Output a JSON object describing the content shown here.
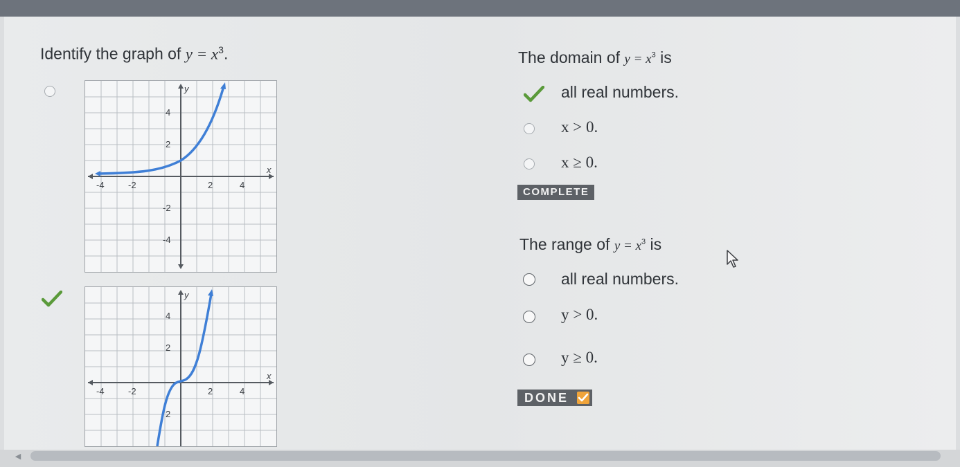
{
  "left_question": {
    "prompt_text": "Identify the graph of ",
    "equation": "y = x",
    "exponent": "3",
    "trailing": "."
  },
  "graph_options": [
    {
      "state": "unselected",
      "y_label": "y",
      "x_label": "x",
      "x_ticks": [
        "-4",
        "-2",
        "2",
        "4"
      ],
      "y_ticks": [
        "4",
        "2",
        "-2",
        "-4"
      ]
    },
    {
      "state": "correct",
      "y_label": "y",
      "x_label": "x",
      "x_ticks": [
        "-4",
        "-2",
        "2",
        "4"
      ],
      "y_ticks": [
        "4",
        "2",
        "2"
      ]
    }
  ],
  "domain_question": {
    "prefix": "The domain of ",
    "equation": "y = x",
    "exponent": "3",
    "suffix": " is",
    "options": [
      {
        "label": "all real numbers.",
        "state": "correct"
      },
      {
        "label": "x > 0.",
        "state": "unselected"
      },
      {
        "label": "x ≥ 0.",
        "state": "unselected"
      }
    ],
    "badge": "COMPLETE"
  },
  "range_question": {
    "prefix": "The range of ",
    "equation": "y = x",
    "exponent": "3",
    "suffix": " is",
    "options": [
      {
        "label": "all real numbers.",
        "state": "unselected"
      },
      {
        "label": "y > 0.",
        "state": "unselected"
      },
      {
        "label": "y ≥ 0.",
        "state": "unselected"
      }
    ],
    "button": "DONE"
  },
  "icons": {
    "check": "check-icon",
    "cursor": "mouse-pointer-icon",
    "scroll_left": "chevron-left-icon"
  },
  "colors": {
    "check_green": "#5a9a3a",
    "curve_blue": "#3f7fd6",
    "done_orange": "#f0a43a"
  }
}
